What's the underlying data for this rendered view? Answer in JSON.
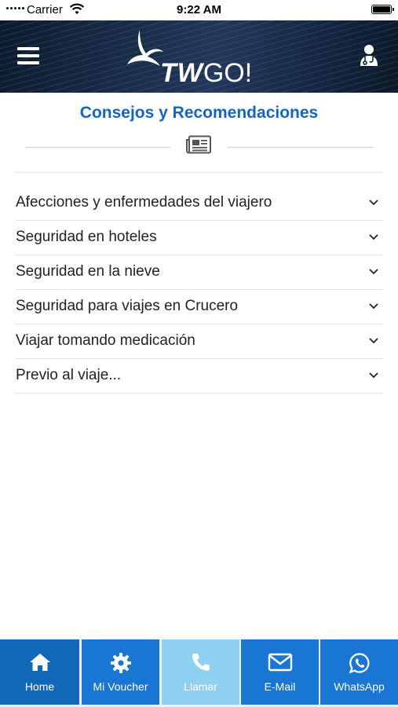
{
  "status_bar": {
    "carrier": "Carrier",
    "time": "9:22 AM"
  },
  "header": {
    "logo_text": "TW",
    "logo_text_go": "GO!"
  },
  "main": {
    "title": "Consejos y Recomendaciones",
    "items": [
      {
        "label": "Afecciones y enfermedades del viajero"
      },
      {
        "label": "Seguridad en hoteles"
      },
      {
        "label": "Seguridad en la nieve"
      },
      {
        "label": "Seguridad para viajes en Crucero"
      },
      {
        "label": "Viajar tomando medicación"
      },
      {
        "label": "Previo al viaje..."
      }
    ]
  },
  "tabbar": {
    "tabs": [
      {
        "label": "Home",
        "icon": "home-icon"
      },
      {
        "label": "Mi Voucher",
        "icon": "gear-icon"
      },
      {
        "label": "Llamar",
        "icon": "phone-icon"
      },
      {
        "label": "E-Mail",
        "icon": "envelope-icon"
      },
      {
        "label": "WhatsApp",
        "icon": "whatsapp-icon"
      }
    ]
  },
  "colors": {
    "accent": "#1565c0",
    "tab_blue": "#1976d2",
    "tab_home": "#1267b8",
    "tab_active": "#8fd0f2",
    "header_dark": "#142640"
  }
}
